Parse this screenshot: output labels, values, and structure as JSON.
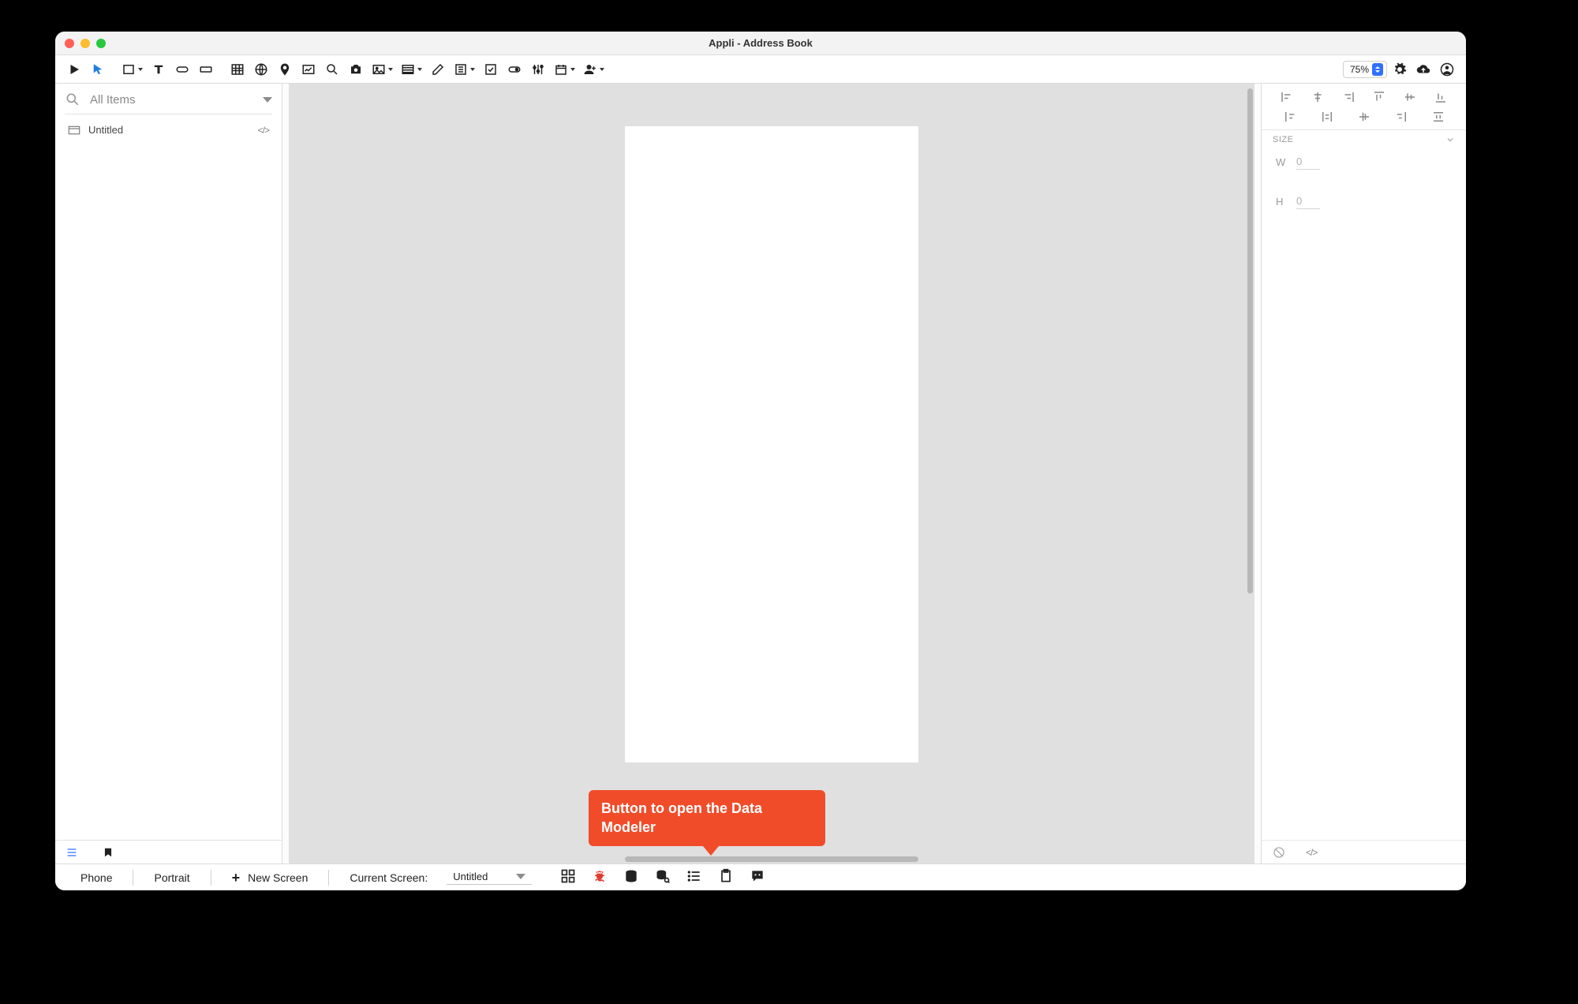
{
  "window": {
    "title": "Appli - Address Book"
  },
  "toolbar": {
    "zoom": "75%"
  },
  "left_panel": {
    "search_placeholder": "All Items",
    "items": [
      {
        "label": "Untitled"
      }
    ]
  },
  "inspector": {
    "section_size": "SIZE",
    "w_label": "W",
    "w_value": "0",
    "h_label": "H",
    "h_value": "0"
  },
  "status": {
    "device": "Phone",
    "orientation": "Portrait",
    "new_screen": "New Screen",
    "current_screen_label": "Current Screen:",
    "current_screen_value": "Untitled"
  },
  "callout": {
    "text": "Button to open the Data Modeler"
  }
}
